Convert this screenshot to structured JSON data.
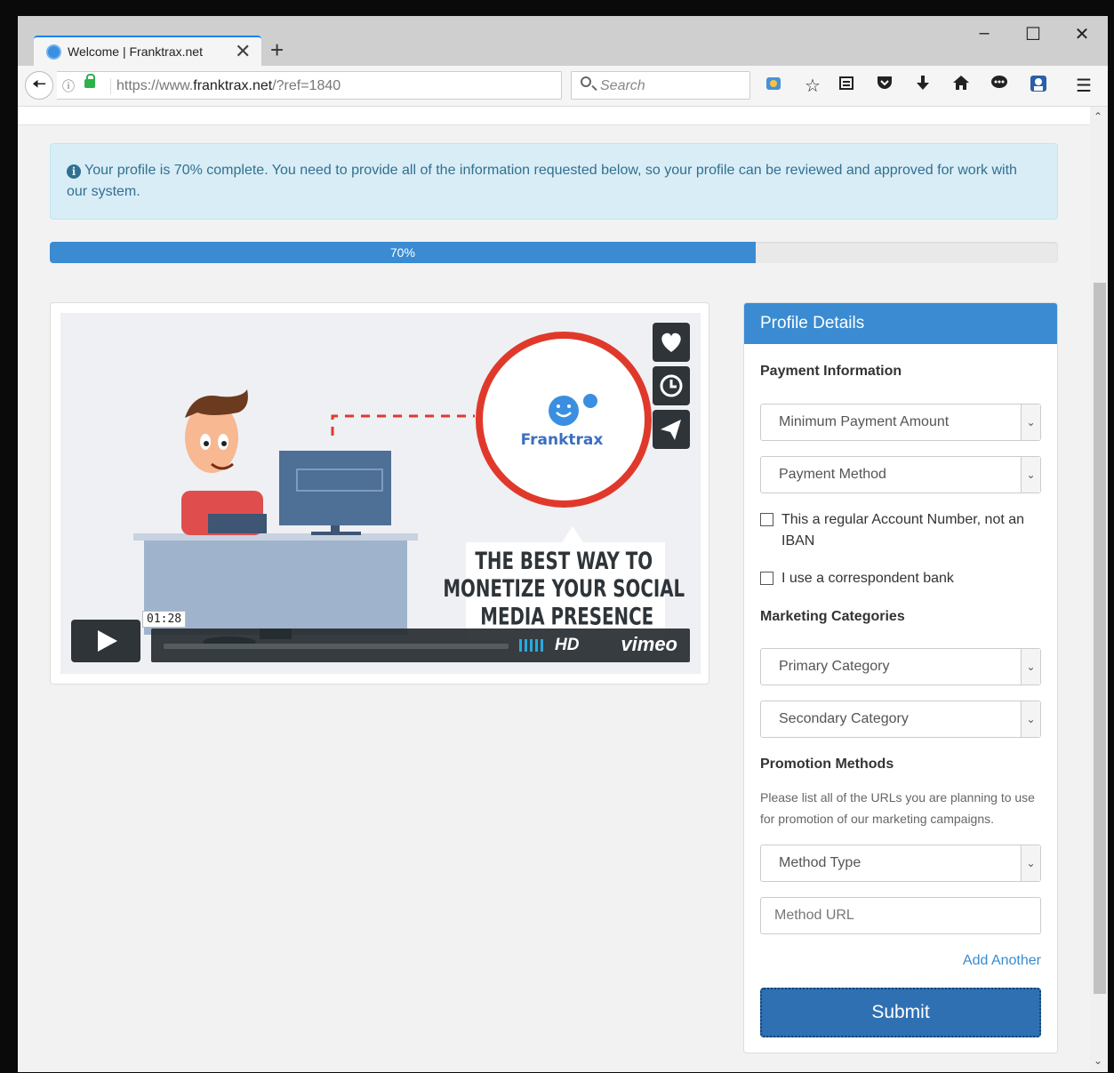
{
  "browser": {
    "tab_title": "Welcome | Franktrax.net",
    "tab_close": "✕",
    "new_tab": "+",
    "url_prefix": "https://www.",
    "url_domain": "franktrax.net",
    "url_path": "/?ref=1840",
    "search_placeholder": "Search",
    "window_controls": {
      "minimize": "–",
      "maximize": "☐",
      "close": "✕"
    }
  },
  "alert": {
    "icon": "i",
    "text": "Your profile is 70% complete. You need to provide all of the information requested below, so your profile can be reviewed and approved for work with our system."
  },
  "progress": {
    "value": 70,
    "label": "70%"
  },
  "video": {
    "brand_logo_text": "Franktrax",
    "headline": "THE BEST WAY TO MONETIZE YOUR SOCIAL MEDIA PRESENCE",
    "timecode": "01:28",
    "hd_label": "HD",
    "provider": "vimeo",
    "side_buttons": [
      "heart-icon",
      "clock-icon",
      "send-icon"
    ]
  },
  "profile": {
    "heading": "Profile Details",
    "payment_title": "Payment Information",
    "min_payment": "Minimum Payment Amount",
    "payment_method": "Payment Method",
    "check_regular_account": "This a regular Account Number, not an IBAN",
    "check_correspondent": "I use a correspondent bank",
    "marketing_title": "Marketing Categories",
    "primary_category": "Primary Category",
    "secondary_category": "Secondary Category",
    "promotion_title": "Promotion Methods",
    "promotion_help": "Please list all of the URLs you are planning to use for promotion of our marketing campaigns.",
    "method_type": "Method Type",
    "method_url_placeholder": "Method URL",
    "add_another": "Add Another",
    "submit": "Submit"
  },
  "colors": {
    "primary": "#3a8bd1",
    "alert_bg": "#d9edf7",
    "alert_text": "#31708f",
    "submit_bg": "#2f70b3",
    "brand_red": "#e0392b"
  }
}
